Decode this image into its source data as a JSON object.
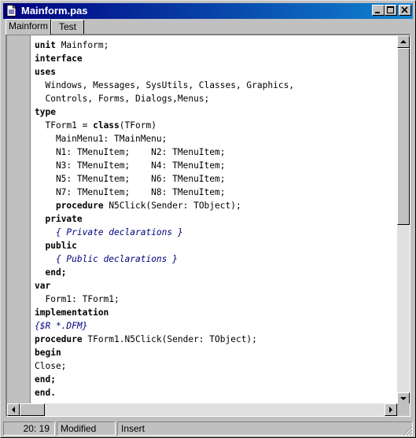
{
  "window": {
    "title": "Mainform.pas"
  },
  "tabs": [
    {
      "label": "Mainform",
      "active": true
    },
    {
      "label": "Test",
      "active": false
    }
  ],
  "code_lines": [
    [
      {
        "t": "unit",
        "k": 1
      },
      {
        "t": " Mainform;"
      }
    ],
    [
      {
        "t": "interface",
        "k": 1
      }
    ],
    [
      {
        "t": "uses",
        "k": 1
      }
    ],
    [
      {
        "t": "  Windows, Messages, SysUtils, Classes, Graphics,"
      }
    ],
    [
      {
        "t": "  Controls, Forms, Dialogs,Menus;"
      }
    ],
    [
      {
        "t": "type",
        "k": 1
      }
    ],
    [
      {
        "t": "  TForm1 = "
      },
      {
        "t": "class",
        "k": 1
      },
      {
        "t": "(TForm)"
      }
    ],
    [
      {
        "t": "    MainMenu1: TMainMenu;"
      }
    ],
    [
      {
        "t": "    N1: TMenuItem;    N2: TMenuItem;"
      }
    ],
    [
      {
        "t": "    N3: TMenuItem;    N4: TMenuItem;"
      }
    ],
    [
      {
        "t": "    N5: TMenuItem;    N6: TMenuItem;"
      }
    ],
    [
      {
        "t": "    N7: TMenuItem;    N8: TMenuItem;"
      }
    ],
    [
      {
        "t": "    "
      },
      {
        "t": "procedure",
        "k": 1
      },
      {
        "t": " N5Click(Sender: TObject);"
      }
    ],
    [
      {
        "t": "  "
      },
      {
        "t": "private",
        "k": 1
      }
    ],
    [
      {
        "t": "    "
      },
      {
        "t": "{ Private declarations }",
        "c": 1
      }
    ],
    [
      {
        "t": "  "
      },
      {
        "t": "public",
        "k": 1
      }
    ],
    [
      {
        "t": "    "
      },
      {
        "t": "{ Public declarations }",
        "c": 1
      }
    ],
    [
      {
        "t": "  "
      },
      {
        "t": "end;",
        "k": 1
      }
    ],
    [
      {
        "t": "var",
        "k": 1
      }
    ],
    [
      {
        "t": "  Form1: TForm1;"
      }
    ],
    [
      {
        "t": "implementation",
        "k": 1
      }
    ],
    [
      {
        "t": "{$R *.DFM}",
        "c": 1
      }
    ],
    [
      {
        "t": "procedure",
        "k": 1
      },
      {
        "t": " TForm1.N5Click(Sender: TObject);"
      }
    ],
    [
      {
        "t": "begin",
        "k": 1
      }
    ],
    [
      {
        "t": "Close;"
      }
    ],
    [
      {
        "t": "end;",
        "k": 1
      }
    ],
    [
      {
        "t": "end.",
        "k": 1
      }
    ]
  ],
  "status": {
    "position": "20: 19",
    "modified": "Modified",
    "mode": "Insert"
  }
}
